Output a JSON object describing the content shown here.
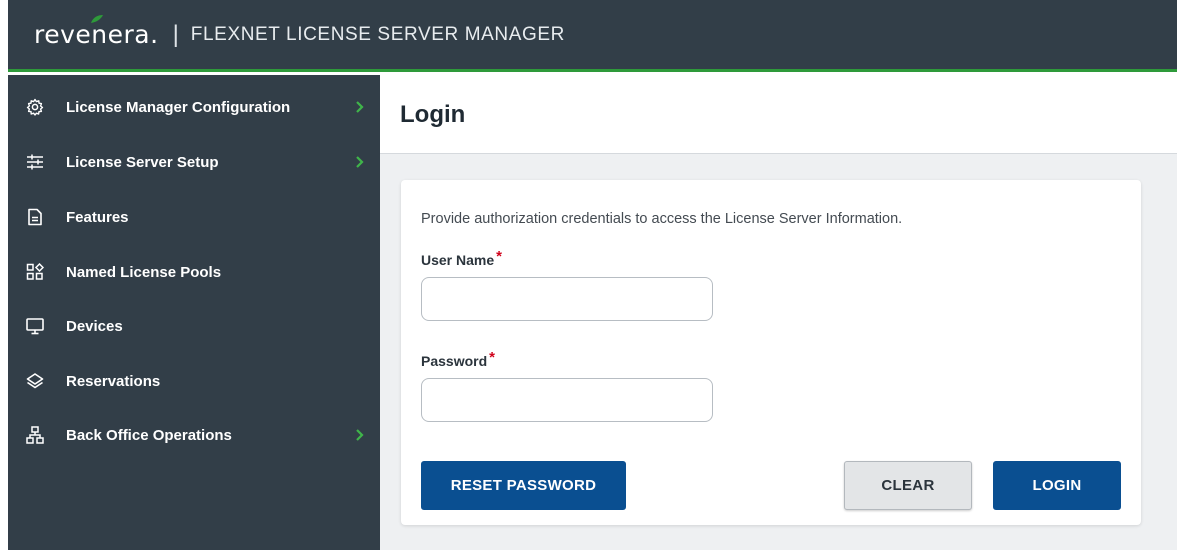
{
  "header": {
    "logo_text": "revenera.",
    "separator": "|",
    "product_name": "FLEXNET LICENSE SERVER MANAGER"
  },
  "sidebar": {
    "items": [
      {
        "label": "License Manager Configuration",
        "icon": "gear-icon",
        "has_submenu": true
      },
      {
        "label": "License Server Setup",
        "icon": "sliders-icon",
        "has_submenu": true
      },
      {
        "label": "Features",
        "icon": "document-icon",
        "has_submenu": false
      },
      {
        "label": "Named License Pools",
        "icon": "grid-icon",
        "has_submenu": false
      },
      {
        "label": "Devices",
        "icon": "monitor-icon",
        "has_submenu": false
      },
      {
        "label": "Reservations",
        "icon": "layers-icon",
        "has_submenu": false
      },
      {
        "label": "Back Office Operations",
        "icon": "hierarchy-icon",
        "has_submenu": true
      }
    ]
  },
  "page": {
    "title": "Login"
  },
  "login_form": {
    "description": "Provide authorization credentials to access the License Server Information.",
    "username_label": "User Name",
    "username_value": "",
    "password_label": "Password",
    "password_value": "",
    "required_marker": "*",
    "reset_password_label": "RESET PASSWORD",
    "clear_label": "CLEAR",
    "login_label": "LOGIN"
  },
  "colors": {
    "header_bg": "#323e48",
    "accent_green": "#2e9a3a",
    "primary_button": "#0a4f91",
    "required_red": "#d0021b"
  }
}
